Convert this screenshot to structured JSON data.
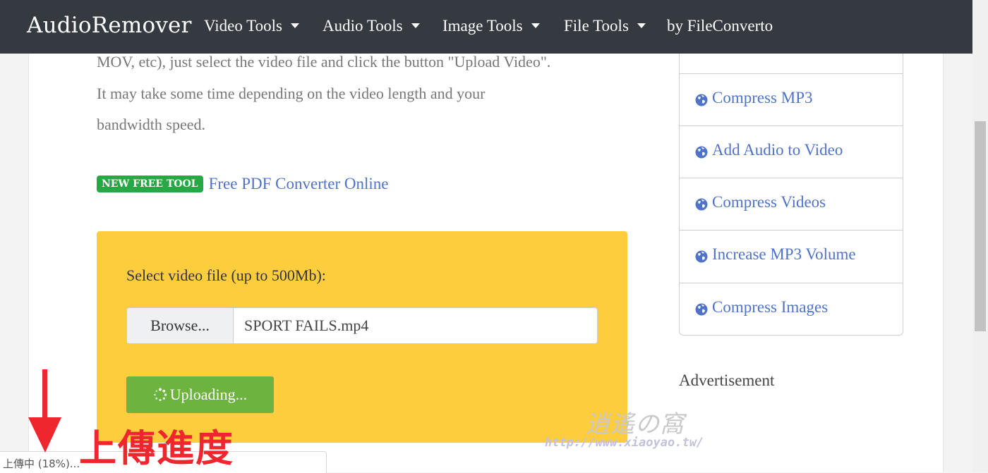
{
  "navbar": {
    "brand": "AudioRemover",
    "items": [
      {
        "label": "Video Tools",
        "dropdown": true
      },
      {
        "label": "Audio Tools",
        "dropdown": true
      },
      {
        "label": "Image Tools",
        "dropdown": true
      },
      {
        "label": "File Tools",
        "dropdown": true
      },
      {
        "label": "by FileConverto",
        "dropdown": false
      }
    ]
  },
  "main": {
    "description_lines": [
      "MOV, etc), just select the video file and click the button \"Upload Video\".",
      "It may take some time depending on the video length and your",
      "bandwidth speed."
    ],
    "promo_badge": "NEW FREE TOOL",
    "promo_link": "Free PDF Converter Online",
    "upload": {
      "label": "Select video file (up to 500Mb):",
      "browse_label": "Browse...",
      "file_name": "SPORT FAILS.mp4",
      "button_label": "Uploading..."
    }
  },
  "sidebar": {
    "items": [
      {
        "label": "Compress MP3",
        "icon": "globe-icon"
      },
      {
        "label": "Add Audio to Video",
        "icon": "globe-icon"
      },
      {
        "label": "Compress Videos",
        "icon": "globe-icon"
      },
      {
        "label": "Increase MP3 Volume",
        "icon": "globe-icon"
      },
      {
        "label": "Compress Images",
        "icon": "globe-icon"
      }
    ],
    "advertisement_label": "Advertisement"
  },
  "status_bar": {
    "text": "上傳中 (18%)..."
  },
  "annotation": {
    "text": "上傳進度",
    "color": "#f0262e"
  },
  "watermark": {
    "title": "逍遙の窩",
    "url": "http://www.xiaoyao.tw/"
  },
  "colors": {
    "navbar_bg": "#343a40",
    "link": "#4f73c9",
    "upload_box": "#fecd3e",
    "upload_button": "#6db33f",
    "badge": "#28a745"
  }
}
